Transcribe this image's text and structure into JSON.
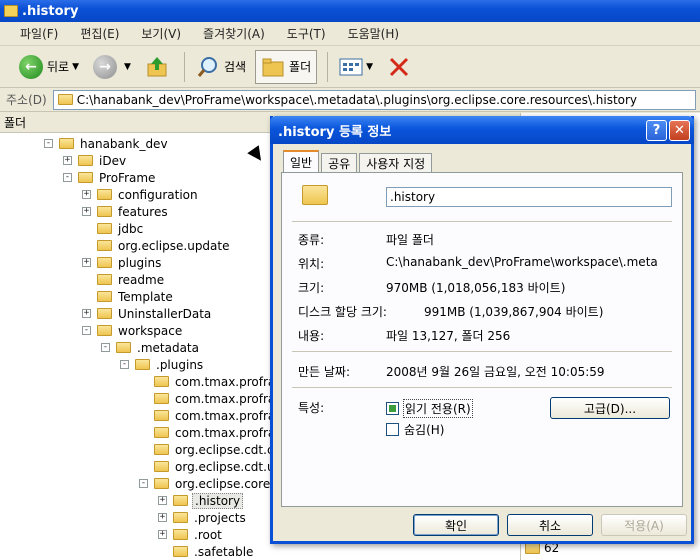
{
  "explorer": {
    "title": ".history",
    "menu": [
      "파일(F)",
      "편집(E)",
      "보기(V)",
      "즐겨찾기(A)",
      "도구(T)",
      "도움말(H)"
    ],
    "toolbar": {
      "back_label": "뒤로",
      "search_label": "검색",
      "folders_label": "폴더"
    },
    "address": {
      "label": "주소(D)",
      "value": "C:\\hanabank_dev\\ProFrame\\workspace\\.metadata\\.plugins\\org.eclipse.core.resources\\.history"
    },
    "folders_pane_title": "폴더",
    "right_pane_item": "62",
    "tree": [
      {
        "label": "hanabank_dev",
        "level": 0,
        "exp": "-"
      },
      {
        "label": "iDev",
        "level": 1,
        "exp": "+"
      },
      {
        "label": "ProFrame",
        "level": 1,
        "exp": "-"
      },
      {
        "label": "configuration",
        "level": 2,
        "exp": "+"
      },
      {
        "label": "features",
        "level": 2,
        "exp": "+"
      },
      {
        "label": "jdbc",
        "level": 2,
        "exp": ""
      },
      {
        "label": "org.eclipse.update",
        "level": 2,
        "exp": ""
      },
      {
        "label": "plugins",
        "level": 2,
        "exp": "+"
      },
      {
        "label": "readme",
        "level": 2,
        "exp": ""
      },
      {
        "label": "Template",
        "level": 2,
        "exp": ""
      },
      {
        "label": "UninstallerData",
        "level": 2,
        "exp": "+"
      },
      {
        "label": "workspace",
        "level": 2,
        "exp": "-"
      },
      {
        "label": ".metadata",
        "level": 3,
        "exp": "-"
      },
      {
        "label": ".plugins",
        "level": 4,
        "exp": "-"
      },
      {
        "label": "com.tmax.profran",
        "level": 5,
        "exp": ""
      },
      {
        "label": "com.tmax.profran",
        "level": 5,
        "exp": ""
      },
      {
        "label": "com.tmax.profran",
        "level": 5,
        "exp": ""
      },
      {
        "label": "com.tmax.profran",
        "level": 5,
        "exp": ""
      },
      {
        "label": "org.eclipse.cdt.c",
        "level": 5,
        "exp": ""
      },
      {
        "label": "org.eclipse.cdt.u",
        "level": 5,
        "exp": ""
      },
      {
        "label": "org.eclipse.core.",
        "level": 5,
        "exp": "-"
      },
      {
        "label": ".history",
        "level": 6,
        "exp": "+",
        "selected": true
      },
      {
        "label": ".projects",
        "level": 6,
        "exp": "+"
      },
      {
        "label": ".root",
        "level": 6,
        "exp": "+"
      },
      {
        "label": ".safetable",
        "level": 6,
        "exp": ""
      }
    ]
  },
  "dialog": {
    "title": ".history 등록 정보",
    "help_glyph": "?",
    "close_glyph": "✕",
    "tabs": [
      "일반",
      "공유",
      "사용자 지정"
    ],
    "name": ".history",
    "props": {
      "type_label": "종류:",
      "type_value": "파일 폴더",
      "location_label": "위치:",
      "location_value": "C:\\hanabank_dev\\ProFrame\\workspace\\.meta",
      "size_label": "크기:",
      "size_value": "970MB (1,018,056,183 바이트)",
      "disk_label": "디스크 할당 크기:",
      "disk_value": "991MB (1,039,867,904 바이트)",
      "contents_label": "내용:",
      "contents_value": "파일 13,127, 폴더 256",
      "created_label": "만든 날짜:",
      "created_value": "2008년 9월 26일 금요일, 오전 10:05:59",
      "attrs_label": "특성:",
      "readonly_label": "읽기 전용(R)",
      "hidden_label": "숨김(H)",
      "advanced_label": "고급(D)..."
    },
    "buttons": {
      "ok": "확인",
      "cancel": "취소",
      "apply": "적용(A)"
    }
  }
}
